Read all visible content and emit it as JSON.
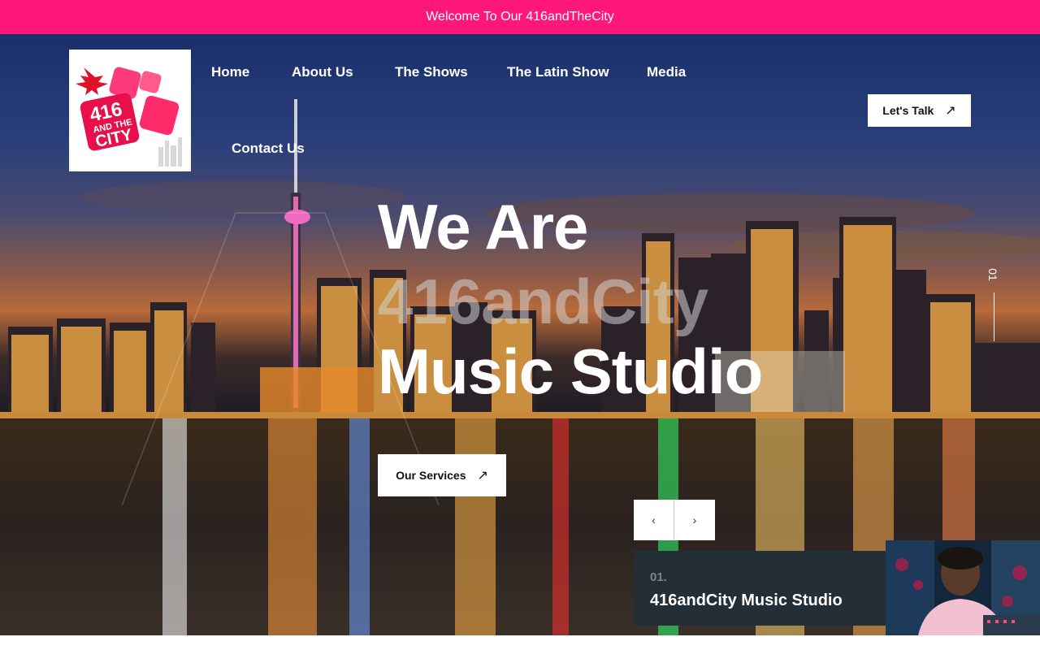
{
  "announcement": "Welcome To Our 416andTheCity",
  "logo": {
    "line1": "416",
    "line2": "AND THE",
    "line3": "CITY"
  },
  "nav": {
    "items": [
      "Home",
      "About Us",
      "The Shows",
      "The Latin Show",
      "Media",
      "Contact Us"
    ]
  },
  "cta": {
    "label": "Let's Talk",
    "icon": "arrow-up-right-icon"
  },
  "hero": {
    "line1": "We Are",
    "line2": "416andCity",
    "line3": "Music Studio",
    "button": "Our Services",
    "button_icon": "arrow-up-right-icon"
  },
  "slider": {
    "counter": "01",
    "prev_icon": "chevron-left-icon",
    "next_icon": "chevron-right-icon"
  },
  "card": {
    "number": "01.",
    "title": "416andCity Music Studio"
  },
  "colors": {
    "accent": "#ff1779",
    "card_bg": "#232e36"
  }
}
